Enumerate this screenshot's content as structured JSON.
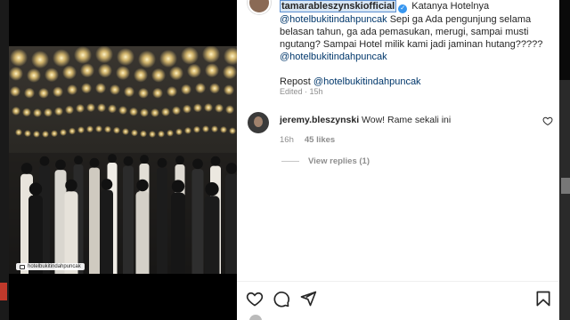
{
  "post": {
    "author": "tamarableszynskiofficial",
    "caption_pre": " Katanya Hotelnya ",
    "caption_mention": "@hotelbukitindahpuncak",
    "caption_body": " Sepi ga Ada pengunjung selama belasan tahun, ga ada pemasukan, merugi, sampai musti ngutang? Sampai Hotel milik kami jadi jaminan hutang????? ",
    "caption_mention2": "@hotelbukitindahpuncak",
    "repost_label": "Repost ",
    "repost_mention": "@hotelbukitindahpuncak",
    "edited": "Edited · 15h",
    "video_caption": "hotelbukitindahpuncak"
  },
  "comment": {
    "user": "jeremy.bleszynski",
    "text": " Wow! Rame sekali ini",
    "time": "16h",
    "likes": "45 likes",
    "view_replies": "View replies (1)"
  },
  "icons": {
    "like": "heart-icon",
    "comment": "comment-icon",
    "share": "send-icon",
    "save": "bookmark-icon",
    "verified": "verified-badge-icon"
  },
  "colors": {
    "mention": "#00376b",
    "verified": "#3897f0",
    "muted": "#8e8e8e"
  }
}
